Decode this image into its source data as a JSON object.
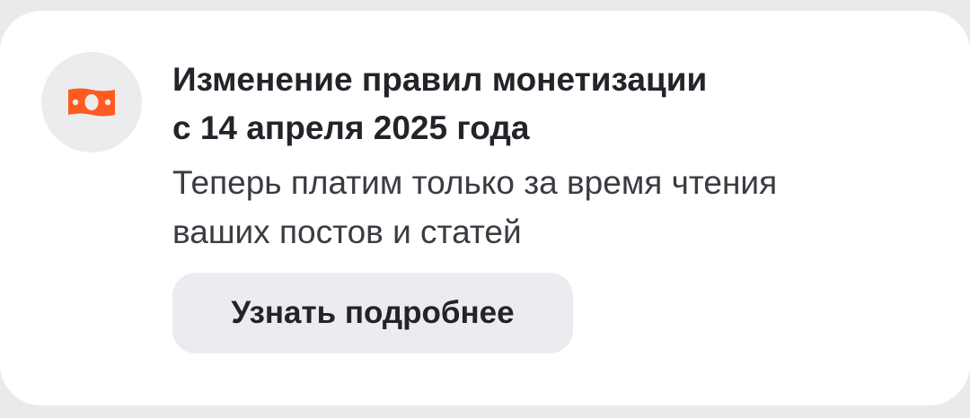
{
  "card": {
    "icon": "money-banknote-icon",
    "icon_color": "#ff5a1f",
    "title_line1": "Изменение правил монетизации",
    "title_line2": "с 14 апреля 2025 года",
    "desc_line1": "Теперь платим только за время чтения",
    "desc_line2": "ваших постов и статей",
    "button_label": "Узнать подробнее"
  }
}
